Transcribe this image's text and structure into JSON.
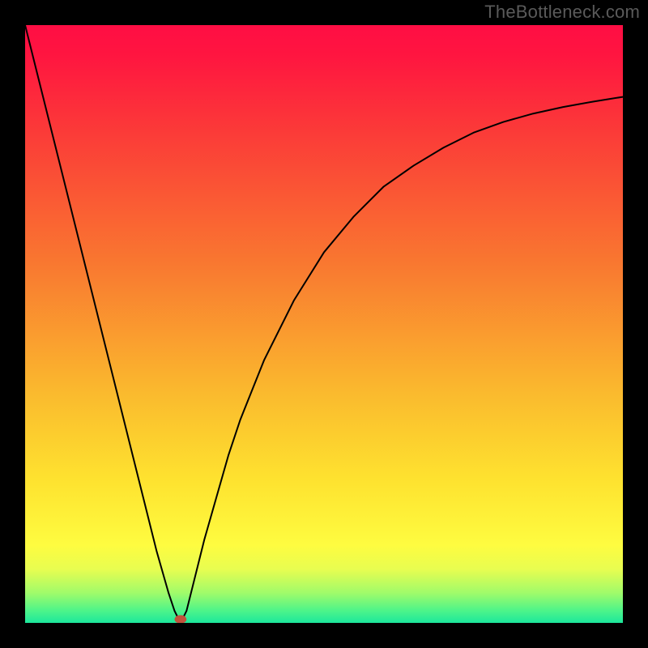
{
  "watermark": "TheBottleneck.com",
  "chart_data": {
    "type": "line",
    "title": "",
    "xlabel": "",
    "ylabel": "",
    "xlim": [
      0,
      100
    ],
    "ylim": [
      0,
      100
    ],
    "grid": false,
    "notch_x": 26,
    "series": [
      {
        "name": "bottleneck-curve",
        "x": [
          0,
          5,
          10,
          15,
          18,
          20,
          22,
          24,
          25,
          26,
          27,
          28,
          30,
          32,
          34,
          36,
          38,
          40,
          45,
          50,
          55,
          60,
          65,
          70,
          75,
          80,
          85,
          90,
          95,
          100
        ],
        "values": [
          100,
          80,
          60,
          40,
          28,
          20,
          12,
          5,
          2,
          0,
          2,
          6,
          14,
          21,
          28,
          34,
          39,
          44,
          54,
          62,
          68,
          73,
          76.5,
          79.5,
          82,
          83.8,
          85.2,
          86.3,
          87.2,
          88
        ]
      }
    ],
    "marker": {
      "x": 26,
      "y": 0,
      "color": "#C1523B",
      "rx": 7,
      "ry": 5
    },
    "gradient_stops": [
      {
        "pos": 0.0,
        "color": "#FF0E44"
      },
      {
        "pos": 0.18,
        "color": "#FB3B38"
      },
      {
        "pos": 0.4,
        "color": "#F97830"
      },
      {
        "pos": 0.62,
        "color": "#FABB2E"
      },
      {
        "pos": 0.76,
        "color": "#FEE22F"
      },
      {
        "pos": 0.87,
        "color": "#FEFC40"
      },
      {
        "pos": 0.95,
        "color": "#A0FB6A"
      },
      {
        "pos": 1.0,
        "color": "#1CE79C"
      }
    ]
  }
}
